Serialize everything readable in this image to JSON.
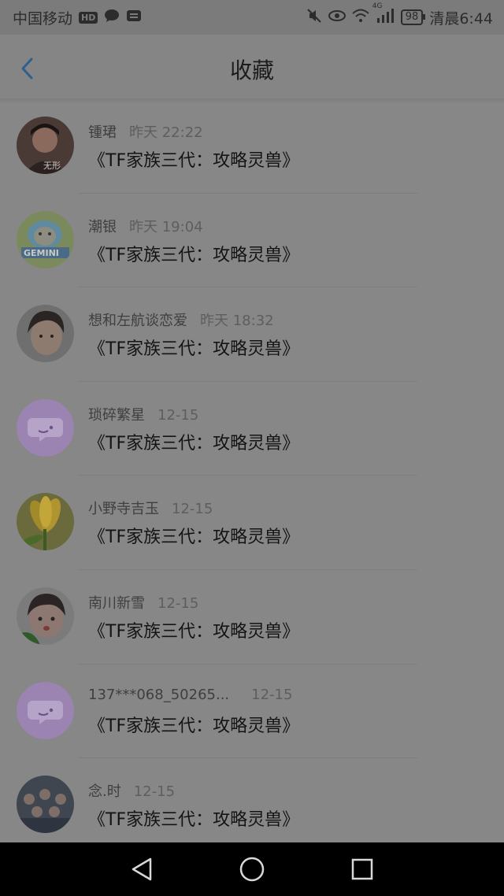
{
  "status_bar": {
    "carrier": "中国移动",
    "hd": "HD",
    "network": "4G",
    "battery": "98",
    "time": "清晨6:44"
  },
  "header": {
    "title": "收藏"
  },
  "items": [
    {
      "name": "锺珺",
      "time": "昨天 22:22",
      "content": "《TF家族三代：攻略灵兽》",
      "avatar_text": "无形"
    },
    {
      "name": "潮银",
      "time": "昨天 19:04",
      "content": "《TF家族三代：攻略灵兽》",
      "avatar_text": "GEMINI"
    },
    {
      "name": "想和左航谈恋爱",
      "time": "昨天 18:32",
      "content": "《TF家族三代：攻略灵兽》",
      "avatar_text": ""
    },
    {
      "name": "琐碎繁星",
      "time": "12-15",
      "content": "《TF家族三代：攻略灵兽》",
      "avatar_text": ""
    },
    {
      "name": "小野寺吉玉",
      "time": "12-15",
      "content": "《TF家族三代：攻略灵兽》",
      "avatar_text": ""
    },
    {
      "name": "南川新雪",
      "time": "12-15",
      "content": "《TF家族三代：攻略灵兽》",
      "avatar_text": ""
    },
    {
      "name": "137***068_50265...",
      "time": "12-15",
      "content": "《TF家族三代：攻略灵兽》",
      "avatar_text": ""
    },
    {
      "name": "念.时",
      "time": "12-15",
      "content": "《TF家族三代：攻略灵兽》",
      "avatar_text": ""
    }
  ],
  "colors": {
    "overlay_bg": "#878787",
    "accent_back": "#2f5f8c",
    "default_avatar": "#9b84b2"
  },
  "icons": {
    "back": "chevron-left-icon",
    "nav_back": "triangle-back-icon",
    "nav_home": "circle-home-icon",
    "nav_recent": "square-recent-icon"
  }
}
